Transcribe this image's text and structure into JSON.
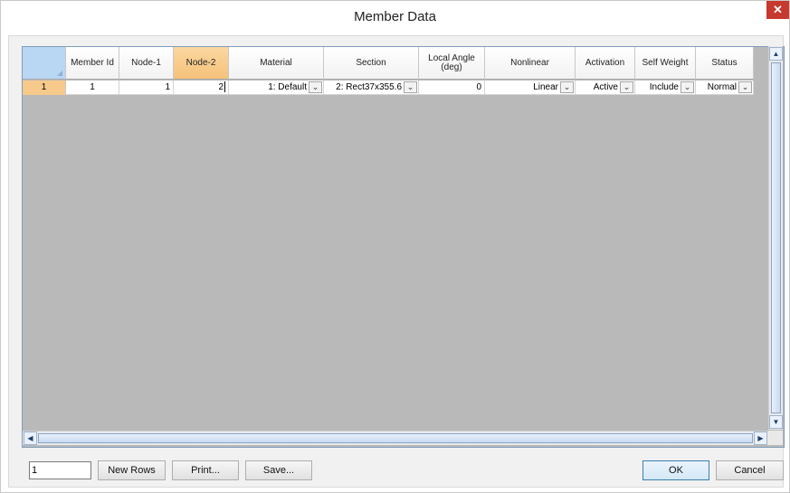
{
  "window": {
    "title": "Member Data",
    "close_label": "✕"
  },
  "grid": {
    "columns": [
      {
        "label": "Member Id",
        "selected": false
      },
      {
        "label": "Node-1",
        "selected": false
      },
      {
        "label": "Node-2",
        "selected": true
      },
      {
        "label": "Material",
        "selected": false
      },
      {
        "label": "Section",
        "selected": false
      },
      {
        "label": "Local Angle (deg)",
        "selected": false
      },
      {
        "label": "Nonlinear",
        "selected": false
      },
      {
        "label": "Activation",
        "selected": false
      },
      {
        "label": "Self Weight",
        "selected": false
      },
      {
        "label": "Status",
        "selected": false
      }
    ],
    "rows": [
      {
        "row_number": "1",
        "member_id": "1",
        "node_1": "1",
        "node_2": "2",
        "material": "1: Default",
        "section": "2: Rect37x355.6",
        "local_angle": "0",
        "nonlinear": "Linear",
        "activation": "Active",
        "self_weight": "Include",
        "status": "Normal"
      }
    ]
  },
  "footer": {
    "rows_count_value": "1",
    "new_rows_label": "New Rows",
    "print_label": "Print...",
    "save_label": "Save...",
    "ok_label": "OK",
    "cancel_label": "Cancel"
  },
  "icons": {
    "dropdown": "chevron-down-icon",
    "scroll_up": "arrow-up-icon",
    "scroll_down": "arrow-down-icon",
    "scroll_left": "arrow-left-icon",
    "scroll_right": "arrow-right-icon"
  },
  "colors": {
    "selected_header": "#f5c27a",
    "row_header": "#f7c98a",
    "grid_background": "#b9b9b9",
    "close_button": "#c7382e"
  }
}
